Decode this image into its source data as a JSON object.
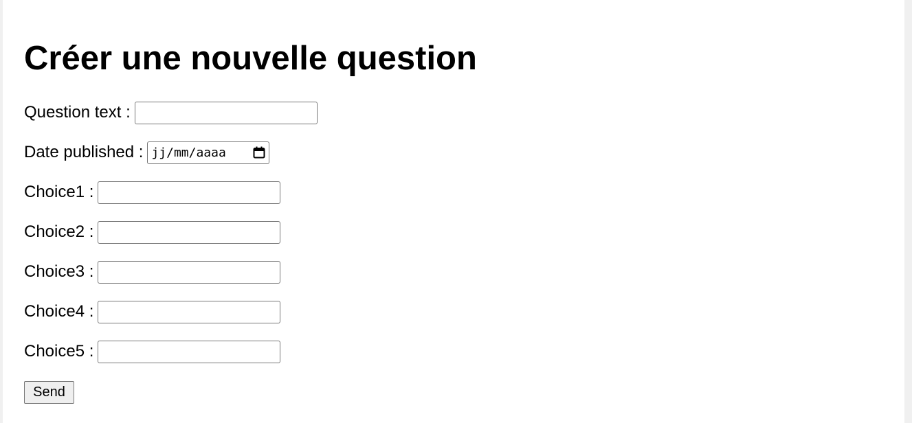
{
  "page": {
    "title": "Créer une nouvelle question"
  },
  "form": {
    "question_text": {
      "label": "Question text :",
      "value": ""
    },
    "date_published": {
      "label": "Date published :",
      "placeholder": "jj/mm/aaaa",
      "icon": "calendar-icon"
    },
    "choices": [
      {
        "label": "Choice1 :",
        "value": ""
      },
      {
        "label": "Choice2 :",
        "value": ""
      },
      {
        "label": "Choice3 :",
        "value": ""
      },
      {
        "label": "Choice4 :",
        "value": ""
      },
      {
        "label": "Choice5 :",
        "value": ""
      }
    ],
    "submit_label": "Send"
  }
}
